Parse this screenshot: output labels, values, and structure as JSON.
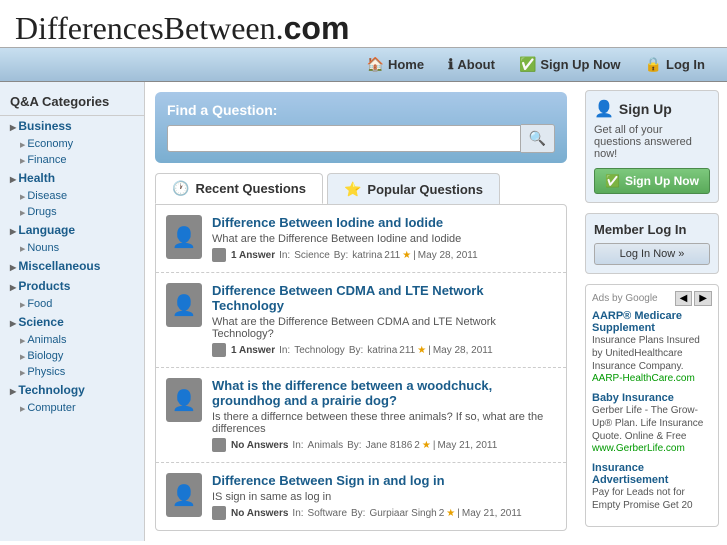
{
  "site": {
    "title": "DifferencesBetween.",
    "title_suffix": "com"
  },
  "nav": {
    "items": [
      {
        "label": "Home",
        "icon": "🏠"
      },
      {
        "label": "About",
        "icon": "ℹ"
      },
      {
        "label": "Sign Up Now",
        "icon": "✅"
      },
      {
        "label": "Log In",
        "icon": "🔒"
      }
    ]
  },
  "sidebar": {
    "title": "Q&A Categories",
    "categories": [
      {
        "label": "Business",
        "type": "main"
      },
      {
        "label": "Economy",
        "type": "sub"
      },
      {
        "label": "Finance",
        "type": "sub"
      },
      {
        "label": "Health",
        "type": "main"
      },
      {
        "label": "Disease",
        "type": "sub"
      },
      {
        "label": "Drugs",
        "type": "sub"
      },
      {
        "label": "Language",
        "type": "main"
      },
      {
        "label": "Nouns",
        "type": "sub"
      },
      {
        "label": "Miscellaneous",
        "type": "main"
      },
      {
        "label": "Products",
        "type": "main"
      },
      {
        "label": "Food",
        "type": "sub"
      },
      {
        "label": "Science",
        "type": "main"
      },
      {
        "label": "Animals",
        "type": "sub"
      },
      {
        "label": "Biology",
        "type": "sub"
      },
      {
        "label": "Physics",
        "type": "sub"
      },
      {
        "label": "Technology",
        "type": "main"
      },
      {
        "label": "Computer",
        "type": "sub"
      }
    ]
  },
  "search": {
    "label": "Find a Question:",
    "placeholder": "",
    "button_icon": "🔍"
  },
  "tabs": [
    {
      "label": "Recent Questions",
      "active": true,
      "icon": "🕐"
    },
    {
      "label": "Popular Questions",
      "active": false,
      "icon": "⭐"
    }
  ],
  "questions": [
    {
      "title": "Difference Between Iodine and Iodide",
      "desc": "What are the Difference Between Iodine and Iodide",
      "answers": "1 Answer",
      "category": "Science",
      "author": "katrina",
      "points": "211",
      "stars": "★",
      "date": "May 28, 2011"
    },
    {
      "title": "Difference Between CDMA and LTE Network Technology",
      "desc": "What are the Difference Between CDMA and LTE Network Technology?",
      "answers": "1 Answer",
      "category": "Technology",
      "author": "katrina",
      "points": "211",
      "stars": "★",
      "date": "May 28, 2011"
    },
    {
      "title": "What is the difference between a woodchuck, groundhog and a prairie dog?",
      "desc": "Is there a differnce between these three animals? If so, what are the differences",
      "answers": "No Answers",
      "category": "Animals",
      "author": "Jane 8186",
      "points": "2",
      "stars": "★",
      "date": "May 21, 2011"
    },
    {
      "title": "Difference Between Sign in and log in",
      "desc": "IS sign in same as log in",
      "answers": "No Answers",
      "category": "Software",
      "author": "Gurpiaar Singh",
      "points": "2",
      "stars": "★",
      "date": "May 21, 2011"
    }
  ],
  "signup": {
    "title": "Sign Up",
    "icon": "👤",
    "desc": "Get all of your questions answered now!",
    "button_label": "Sign Up Now",
    "button_icon": "✅"
  },
  "login": {
    "title": "Member Log In",
    "button_label": "Log In Now »"
  },
  "ads": {
    "header": "Ads by Google",
    "items": [
      {
        "title": "AARP® Medicare Supplement",
        "desc": "Insurance Plans Insured by UnitedHealthcare Insurance Company.",
        "url": "AARP-HealthCare.com"
      },
      {
        "title": "Baby Insurance",
        "desc": "Gerber Life - The Grow-Up® Plan. Life Insurance Quote. Online & Free",
        "url": "www.GerberLife.com"
      },
      {
        "title": "Insurance Advertisement",
        "desc": "Pay for Leads not for Empty Promise Get 20",
        "url": ""
      }
    ]
  }
}
